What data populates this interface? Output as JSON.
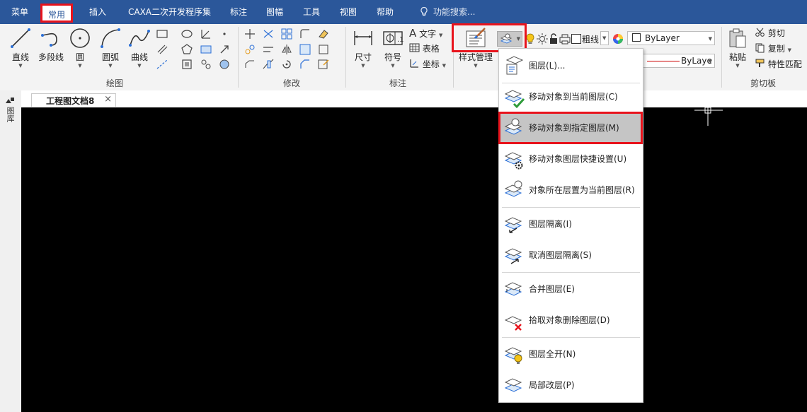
{
  "menubar": {
    "tabs": [
      "菜单",
      "常用",
      "插入",
      "CAXA二次开发程序集",
      "标注",
      "图幅",
      "工具",
      "视图",
      "帮助"
    ],
    "active_tab": "常用",
    "search_placeholder": "功能搜索..."
  },
  "ribbon": {
    "draw": {
      "group_label": "绘图",
      "buttons": [
        "直线",
        "多段线",
        "圆",
        "圆弧",
        "曲线"
      ]
    },
    "modify": {
      "group_label": "修改"
    },
    "annotate": {
      "group_label": "标注",
      "buttons": [
        "尺寸",
        "符号"
      ],
      "small": [
        "文字",
        "表格",
        "坐标"
      ]
    },
    "style": {
      "button_label": "样式管理"
    },
    "properties": {
      "lineweight_label": "粗线",
      "color_value": "ByLayer",
      "linetype_value": "ByLaye"
    },
    "clipboard": {
      "group_label": "剪切板",
      "paste_label": "粘贴",
      "items": [
        "剪切",
        "复制",
        "特性匹配"
      ]
    }
  },
  "document": {
    "tab_title": "工程图文档8",
    "close_glyph": "×",
    "sidebar_label": "图库"
  },
  "layer_menu": {
    "items": [
      {
        "label": "图层(L)...",
        "highlighted": false
      },
      {
        "label": "移动对象到当前图层(C)",
        "highlighted": false
      },
      {
        "label": "移动对象到指定图层(M)",
        "highlighted": true
      },
      {
        "label": "移动对象图层快捷设置(U)",
        "highlighted": false
      },
      {
        "label": "对象所在层置为当前图层(R)",
        "highlighted": false
      },
      {
        "label": "图层隔离(I)",
        "highlighted": false
      },
      {
        "label": "取消图层隔离(S)",
        "highlighted": false
      },
      {
        "label": "合并图层(E)",
        "highlighted": false
      },
      {
        "label": "拾取对象删除图层(D)",
        "highlighted": false
      },
      {
        "label": "图层全开(N)",
        "highlighted": false
      },
      {
        "label": "局部改层(P)",
        "highlighted": false
      }
    ]
  },
  "colors": {
    "menubar": "#2b579a",
    "highlight_border": "#e8131c",
    "canvas": "#000000",
    "menu_highlight": "#c5c5c5"
  }
}
